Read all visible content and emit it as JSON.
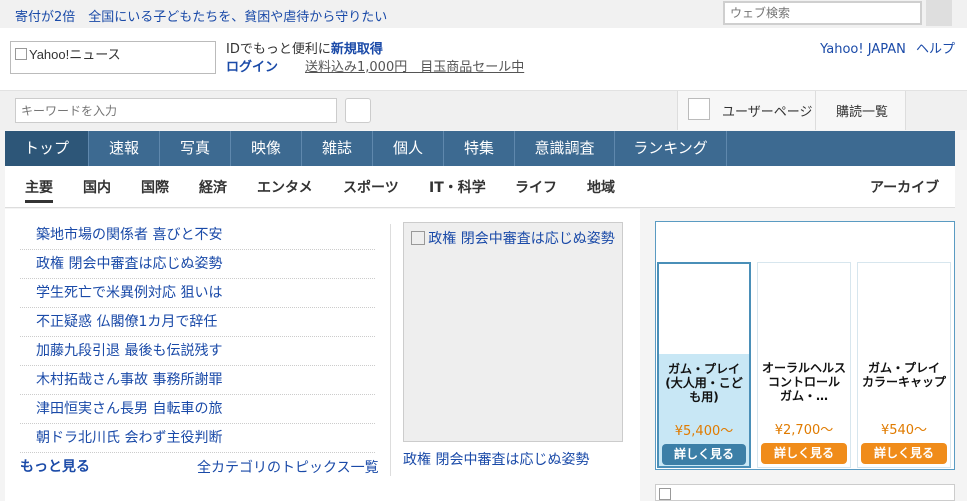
{
  "topbar": {
    "promo": "寄付が2倍　全国にいる子どもたちを、貧困や虐待から守りたい",
    "search_placeholder": "ウェブ検索"
  },
  "header": {
    "logo_alt": "Yahoo!ニュース",
    "id_prefix": "IDでもっと便利に",
    "id_signup": "新規取得",
    "login": "ログイン",
    "sale": "送料込み1,000円　目玉商品セール中",
    "links": [
      "Yahoo! JAPAN",
      "ヘルプ"
    ]
  },
  "kwbar": {
    "placeholder": "キーワードを入力",
    "userpage": "ユーザーページ",
    "subscriptions": "購読一覧"
  },
  "nav1": {
    "tabs": [
      "トップ",
      "速報",
      "写真",
      "映像",
      "雑誌",
      "個人",
      "特集",
      "意識調査",
      "ランキング"
    ]
  },
  "nav2": {
    "items": [
      "主要",
      "国内",
      "国際",
      "経済",
      "エンタメ",
      "スポーツ",
      "IT・科学",
      "ライフ",
      "地域"
    ],
    "archive": "アーカイブ"
  },
  "topics": [
    "築地市場の関係者 喜びと不安",
    "政権 閉会中審査は応じぬ姿勢",
    "学生死亡で米異例対応 狙いは",
    "不正疑惑 仏閣僚1カ月で辞任",
    "加藤九段引退 最後も伝説残す",
    "木村拓哉さん事故 事務所謝罪",
    "津田恒実さん長男 自転車の旅",
    "朝ドラ北川氏 会わず主役判断"
  ],
  "topic_footer": {
    "more": "もっと見る",
    "all_categories": "全カテゴリのトピックス一覧"
  },
  "photo": {
    "alt": "政権 閉会中審査は応じぬ姿勢",
    "caption": "政権 閉会中審査は応じぬ姿勢"
  },
  "ad": {
    "cards": [
      {
        "name": "ガム・プレイ (大人用・こども用)",
        "price": "¥5,400〜",
        "button": "詳しく見る"
      },
      {
        "name": "オーラルヘルスコントロール　ガム・…",
        "price": "¥2,700〜",
        "button": "詳しく見る"
      },
      {
        "name": "ガム・プレイ　カラーキャップ",
        "price": "¥540〜",
        "button": "詳しく見る"
      }
    ]
  }
}
